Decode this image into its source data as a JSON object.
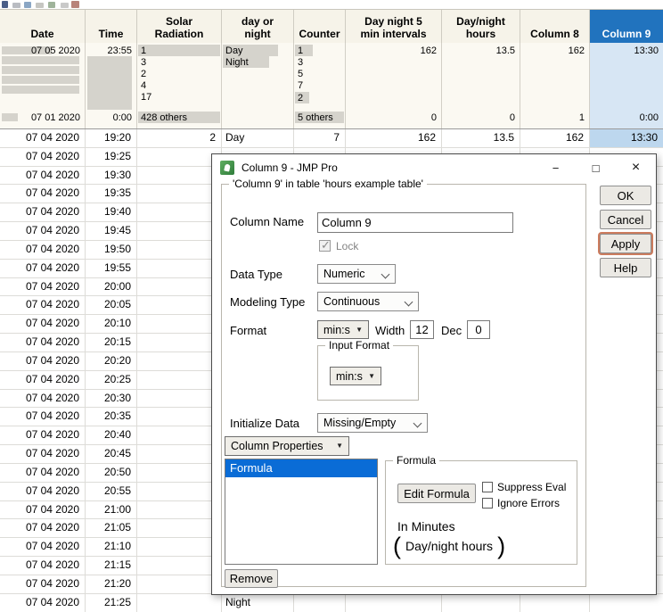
{
  "table": {
    "headers": [
      "Date",
      "Time",
      "Solar\nRadiation",
      "day or\nnight",
      "Counter",
      "Day night 5\nmin intervals",
      "Day/night\nhours",
      "Column 8",
      "Column 9"
    ],
    "summary": {
      "date_top": "07 05 2020",
      "date_bottom": "07 01 2020",
      "time_top": "23:55",
      "time_bottom": "0:00",
      "solar": [
        "1",
        "3",
        "2",
        "4",
        "17"
      ],
      "solar_more": "428 others",
      "daynight": [
        "Day",
        "Night"
      ],
      "counter": [
        "1",
        "3",
        "5",
        "7",
        "2"
      ],
      "counter_more": "5 others",
      "intervals_top": "162",
      "intervals_bottom": "0",
      "hours_top": "13.5",
      "hours_bottom": "0",
      "col8_top": "162",
      "col8_bottom": "1",
      "col9_top": "13:30",
      "col9_bottom": "0:00"
    },
    "rows": [
      {
        "date": "07 04 2020",
        "time": "19:20",
        "solar": "2",
        "day_night": "Day",
        "counter": "7",
        "intervals": "162",
        "hours": "13.5",
        "col8": "162",
        "col9": "13:30",
        "col9_selected": true
      },
      {
        "date": "07 04 2020",
        "time": "19:25"
      },
      {
        "date": "07 04 2020",
        "time": "19:30"
      },
      {
        "date": "07 04 2020",
        "time": "19:35"
      },
      {
        "date": "07 04 2020",
        "time": "19:40"
      },
      {
        "date": "07 04 2020",
        "time": "19:45"
      },
      {
        "date": "07 04 2020",
        "time": "19:50"
      },
      {
        "date": "07 04 2020",
        "time": "19:55"
      },
      {
        "date": "07 04 2020",
        "time": "20:00"
      },
      {
        "date": "07 04 2020",
        "time": "20:05"
      },
      {
        "date": "07 04 2020",
        "time": "20:10"
      },
      {
        "date": "07 04 2020",
        "time": "20:15"
      },
      {
        "date": "07 04 2020",
        "time": "20:20"
      },
      {
        "date": "07 04 2020",
        "time": "20:25"
      },
      {
        "date": "07 04 2020",
        "time": "20:30"
      },
      {
        "date": "07 04 2020",
        "time": "20:35"
      },
      {
        "date": "07 04 2020",
        "time": "20:40"
      },
      {
        "date": "07 04 2020",
        "time": "20:45"
      },
      {
        "date": "07 04 2020",
        "time": "20:50"
      },
      {
        "date": "07 04 2020",
        "time": "20:55"
      },
      {
        "date": "07 04 2020",
        "time": "21:00"
      },
      {
        "date": "07 04 2020",
        "time": "21:05"
      },
      {
        "date": "07 04 2020",
        "time": "21:10"
      },
      {
        "date": "07 04 2020",
        "time": "21:15"
      },
      {
        "date": "07 04 2020",
        "time": "21:20"
      },
      {
        "date": "07 04 2020",
        "time": "21:25",
        "day_night": "Night"
      }
    ]
  },
  "dialog": {
    "title": "Column 9 - JMP Pro",
    "group_title": "'Column 9' in table 'hours example table'",
    "column_name_label": "Column Name",
    "column_name_value": "Column 9",
    "lock_label": "Lock",
    "data_type_label": "Data Type",
    "data_type_value": "Numeric",
    "modeling_type_label": "Modeling Type",
    "modeling_type_value": "Continuous",
    "format_label": "Format",
    "format_value": "min:s",
    "width_label": "Width",
    "width_value": "12",
    "dec_label": "Dec",
    "dec_value": "0",
    "input_format_label": "Input Format",
    "input_format_value": "min:s",
    "initialize_label": "Initialize Data",
    "initialize_value": "Missing/Empty",
    "column_properties_label": "Column Properties",
    "properties_list": [
      "Formula"
    ],
    "formula_group_label": "Formula",
    "edit_formula_label": "Edit Formula",
    "suppress_eval_label": "Suppress Eval",
    "ignore_errors_label": "Ignore Errors",
    "formula_comment": "In Minutes",
    "formula_expression": "Day/night hours",
    "paren_open": "(",
    "paren_close": ")",
    "remove_label": "Remove",
    "buttons": {
      "ok": "OK",
      "cancel": "Cancel",
      "apply": "Apply",
      "help": "Help"
    }
  },
  "icons": {
    "app_icon": "jmp-logo",
    "minimize_glyph": "−",
    "maximize_glyph": "□",
    "close_glyph": "×",
    "popup_arrow_glyph": "▼",
    "check_glyph": "✓"
  },
  "colors": {
    "selected_column_header": "#2173BE",
    "selected_cell": "#BDD7EE",
    "selected_column_summary": "#D7E6F4",
    "list_selection": "#0A6CD6",
    "apply_focus_ring": "#CD7C5E",
    "table_header_bg": "#F6F3E9",
    "app_icon_green": "#3E8F4A"
  }
}
